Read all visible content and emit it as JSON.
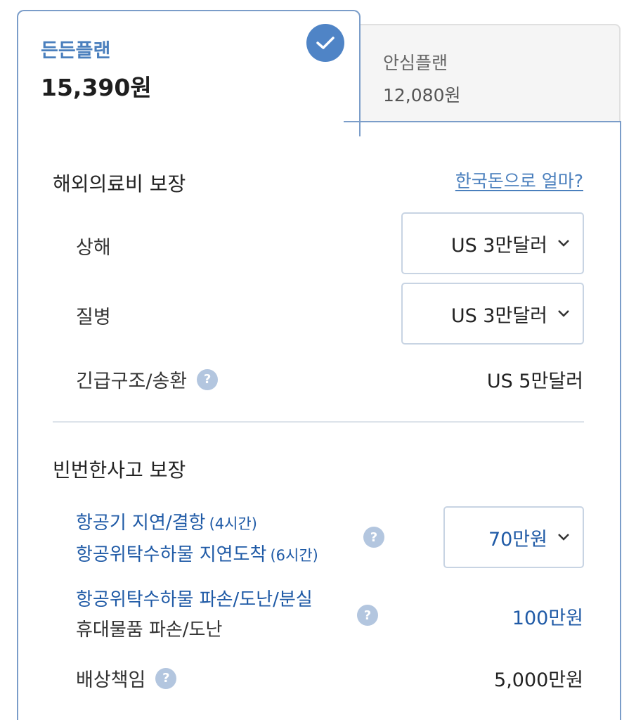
{
  "plans": {
    "active": {
      "name": "든든플랜",
      "price": "15,390원"
    },
    "inactive": {
      "name": "안심플랜",
      "price": "12,080원"
    }
  },
  "medical": {
    "title": "해외의료비 보장",
    "link": "한국돈으로 얼마?",
    "injury": {
      "label": "상해",
      "value": "US 3만달러"
    },
    "disease": {
      "label": "질병",
      "value": "US 3만달러"
    },
    "rescue": {
      "label": "긴급구조/송환",
      "value": "US 5만달러"
    }
  },
  "accident": {
    "title": "빈번한사고 보장",
    "flight": {
      "line1": "항공기 지연/결항",
      "line1_note": "(4시간)",
      "line2": "항공위탁수하물 지연도착",
      "line2_note": "(6시간)",
      "value": "70만원"
    },
    "baggage": {
      "line1": "항공위탁수하물 파손/도난/분실",
      "line2": "휴대물품 파손/도난",
      "value": "100만원"
    },
    "liability": {
      "label": "배상책임",
      "value": "5,000만원"
    }
  },
  "help_glyph": "?",
  "colors": {
    "accent": "#4f84c6",
    "link": "#4a7fbd",
    "blue_text": "#1f5aa6",
    "help_bg": "#b3c6df"
  },
  "icons": {
    "check": "check-icon",
    "chevron": "chevron-down-icon",
    "help": "question-icon"
  }
}
